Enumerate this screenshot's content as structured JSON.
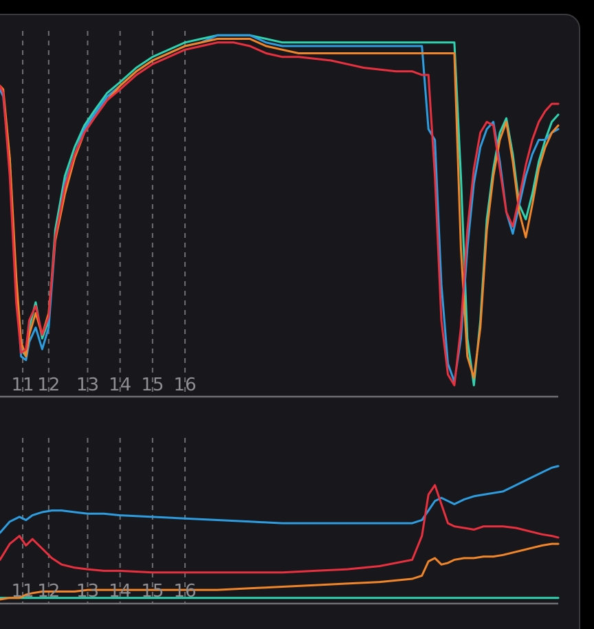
{
  "colors": {
    "panel_bg": "#18181c",
    "panel_border": "#3a3a3e",
    "axis": "#6e6e73",
    "gridline": "#6e6e73",
    "tick_text": "#8e8e93",
    "series": [
      "#2fd3b0",
      "#2d9de0",
      "#f0852a",
      "#e8303e"
    ]
  },
  "chart_data": [
    {
      "type": "line",
      "title": "",
      "xlabel": "",
      "ylabel": "",
      "grid": "vertical dashed lines at labeled x positions",
      "x_ticks": [
        {
          "label": "11",
          "x": 11.0
        },
        {
          "label": "12",
          "x": 11.8
        },
        {
          "label": "13",
          "x": 13.0
        },
        {
          "label": "14",
          "x": 14.0
        },
        {
          "label": "15",
          "x": 15.0
        },
        {
          "label": "16",
          "x": 16.0
        }
      ],
      "series": [
        {
          "x": [
            10.3,
            10.4,
            10.6,
            10.8,
            10.95,
            11.1,
            11.2,
            11.4,
            11.6,
            11.8,
            12.0,
            12.3,
            12.6,
            12.9,
            13.2,
            13.6,
            14.0,
            14.5,
            15.0,
            15.5,
            16.0,
            16.5,
            17.0,
            17.5,
            18.0,
            18.5,
            19.0,
            19.5,
            20.5,
            21.5,
            22.5,
            23.0,
            23.3,
            23.5,
            23.7,
            23.9,
            24.1,
            24.3,
            24.5,
            24.7,
            24.9,
            25.1,
            25.3,
            25.5,
            25.7,
            25.9,
            26.1,
            26.3,
            26.5,
            26.7,
            26.9,
            27.1,
            27.3,
            27.5
          ],
          "values": [
            85,
            83,
            65,
            30,
            12,
            10,
            18,
            25,
            15,
            20,
            45,
            60,
            68,
            74,
            78,
            83,
            86,
            90,
            93,
            95,
            97,
            98,
            99,
            99,
            99,
            98,
            97,
            97,
            97,
            97,
            97,
            97,
            97,
            97,
            97,
            97,
            97,
            97,
            60,
            15,
            2,
            20,
            48,
            62,
            72,
            76,
            66,
            52,
            48,
            55,
            64,
            70,
            75,
            77
          ]
        },
        {
          "x": [
            10.3,
            10.4,
            10.6,
            10.8,
            10.95,
            11.1,
            11.2,
            11.4,
            11.6,
            11.8,
            12.0,
            12.3,
            12.6,
            12.9,
            13.2,
            13.6,
            14.0,
            14.5,
            15.0,
            15.5,
            16.0,
            16.5,
            17.0,
            17.5,
            18.0,
            18.5,
            19.0,
            19.5,
            20.5,
            21.5,
            22.5,
            23.0,
            23.3,
            23.5,
            23.7,
            23.9,
            24.1,
            24.3,
            24.5,
            24.7,
            24.9,
            25.1,
            25.3,
            25.5,
            25.7,
            25.9,
            26.1,
            26.3,
            26.5,
            26.7,
            26.9,
            27.1,
            27.3,
            27.5
          ],
          "values": [
            84,
            82,
            62,
            28,
            10,
            9,
            14,
            18,
            12,
            18,
            42,
            58,
            66,
            73,
            77,
            82,
            85,
            89,
            92,
            94,
            96,
            97,
            99,
            99,
            99,
            97,
            96,
            96,
            96,
            96,
            96,
            96,
            96,
            73,
            70,
            30,
            8,
            3,
            15,
            40,
            58,
            68,
            73,
            75,
            64,
            50,
            44,
            52,
            60,
            66,
            70,
            70,
            72,
            73
          ]
        },
        {
          "x": [
            10.3,
            10.4,
            10.6,
            10.8,
            10.95,
            11.1,
            11.2,
            11.4,
            11.6,
            11.8,
            12.0,
            12.3,
            12.6,
            12.9,
            13.2,
            13.6,
            14.0,
            14.5,
            15.0,
            15.5,
            16.0,
            16.5,
            17.0,
            17.5,
            18.0,
            18.5,
            19.0,
            19.5,
            20.5,
            21.5,
            22.5,
            23.0,
            23.3,
            23.5,
            23.7,
            23.9,
            24.1,
            24.3,
            24.5,
            24.7,
            24.9,
            25.1,
            25.3,
            25.5,
            25.7,
            25.9,
            26.1,
            26.3,
            26.5,
            26.7,
            26.9,
            27.1,
            27.3,
            27.5
          ],
          "values": [
            85,
            84,
            65,
            32,
            14,
            10,
            16,
            22,
            16,
            22,
            42,
            55,
            65,
            72,
            76,
            81,
            85,
            89,
            92,
            94,
            96,
            97,
            98,
            98,
            98,
            96,
            95,
            94,
            94,
            94,
            94,
            94,
            94,
            94,
            94,
            94,
            94,
            94,
            40,
            10,
            4,
            18,
            45,
            60,
            70,
            75,
            64,
            50,
            43,
            52,
            62,
            68,
            72,
            74
          ]
        },
        {
          "x": [
            10.3,
            10.4,
            10.6,
            10.8,
            10.95,
            11.1,
            11.2,
            11.4,
            11.6,
            11.8,
            12.0,
            12.3,
            12.6,
            12.9,
            13.2,
            13.6,
            14.0,
            14.5,
            15.0,
            15.5,
            16.0,
            16.5,
            17.0,
            17.5,
            18.0,
            18.5,
            19.0,
            19.5,
            20.5,
            21.5,
            22.5,
            23.0,
            23.3,
            23.5,
            23.7,
            23.9,
            24.1,
            24.3,
            24.5,
            24.7,
            24.9,
            25.1,
            25.3,
            25.5,
            25.7,
            25.9,
            26.1,
            26.3,
            26.5,
            26.7,
            26.9,
            27.1,
            27.3,
            27.5
          ],
          "values": [
            85,
            83,
            60,
            25,
            11,
            12,
            20,
            24,
            16,
            21,
            43,
            57,
            66,
            72,
            76,
            81,
            84,
            88,
            91,
            93,
            95,
            96,
            97,
            97,
            96,
            94,
            93,
            93,
            92,
            90,
            89,
            89,
            88,
            88,
            60,
            20,
            5,
            2,
            18,
            45,
            62,
            72,
            75,
            74,
            62,
            50,
            46,
            54,
            63,
            70,
            75,
            78,
            80,
            80
          ]
        }
      ]
    },
    {
      "type": "line",
      "title": "",
      "xlabel": "",
      "ylabel": "",
      "grid": "vertical dashed lines at labeled x positions",
      "x_ticks": [
        {
          "label": "11",
          "x": 11.0
        },
        {
          "label": "12",
          "x": 11.8
        },
        {
          "label": "13",
          "x": 13.0
        },
        {
          "label": "14",
          "x": 14.0
        },
        {
          "label": "15",
          "x": 15.0
        },
        {
          "label": "16",
          "x": 16.0
        }
      ],
      "series": [
        {
          "x": [
            10.3,
            11.0,
            13.0,
            15.0,
            17.0,
            20.0,
            23.0,
            24.0,
            25.0,
            26.0,
            27.0,
            27.5
          ],
          "values": [
            1,
            1,
            1,
            1,
            1,
            1,
            1,
            1,
            1,
            1,
            1,
            1
          ]
        },
        {
          "x": [
            10.3,
            10.6,
            10.9,
            11.1,
            11.3,
            11.6,
            11.9,
            12.2,
            12.6,
            13.0,
            13.5,
            14.0,
            15.0,
            16.0,
            17.0,
            18.0,
            19.0,
            20.0,
            21.0,
            22.0,
            23.0,
            23.3,
            23.5,
            23.7,
            23.9,
            24.1,
            24.3,
            24.6,
            24.9,
            25.2,
            25.5,
            25.8,
            26.2,
            26.6,
            27.0,
            27.3,
            27.5
          ],
          "values": [
            42,
            49,
            52,
            50,
            53,
            55,
            56,
            56,
            55,
            54,
            54,
            53,
            52,
            51,
            50,
            49,
            48,
            48,
            48,
            48,
            48,
            50,
            56,
            62,
            64,
            62,
            60,
            63,
            65,
            66,
            67,
            68,
            72,
            76,
            80,
            83,
            84
          ]
        },
        {
          "x": [
            10.3,
            10.6,
            10.9,
            11.1,
            11.3,
            11.6,
            11.9,
            12.2,
            12.6,
            13.0,
            13.5,
            14.0,
            15.0,
            16.0,
            17.0,
            18.0,
            19.0,
            20.0,
            21.0,
            22.0,
            23.0,
            23.3,
            23.5,
            23.7,
            23.9,
            24.1,
            24.3,
            24.6,
            24.9,
            25.2,
            25.5,
            25.8,
            26.2,
            26.6,
            27.0,
            27.3,
            27.5
          ],
          "values": [
            0,
            1,
            1,
            3,
            4,
            5,
            5,
            5,
            5,
            6,
            6,
            6,
            6,
            6,
            6,
            7,
            8,
            9,
            10,
            11,
            13,
            15,
            24,
            26,
            22,
            23,
            25,
            26,
            26,
            27,
            27,
            28,
            30,
            32,
            34,
            35,
            35
          ]
        },
        {
          "x": [
            10.3,
            10.6,
            10.9,
            11.1,
            11.3,
            11.6,
            11.9,
            12.2,
            12.6,
            13.0,
            13.5,
            14.0,
            15.0,
            16.0,
            17.0,
            18.0,
            19.0,
            20.0,
            21.0,
            22.0,
            23.0,
            23.3,
            23.5,
            23.7,
            23.9,
            24.1,
            24.3,
            24.6,
            24.9,
            25.2,
            25.5,
            25.8,
            26.2,
            26.6,
            27.0,
            27.3,
            27.5
          ],
          "values": [
            25,
            35,
            40,
            34,
            38,
            32,
            26,
            22,
            20,
            19,
            18,
            18,
            17,
            17,
            17,
            17,
            17,
            18,
            19,
            21,
            25,
            40,
            66,
            72,
            60,
            48,
            46,
            45,
            44,
            46,
            46,
            46,
            45,
            43,
            41,
            40,
            39
          ]
        }
      ]
    }
  ]
}
